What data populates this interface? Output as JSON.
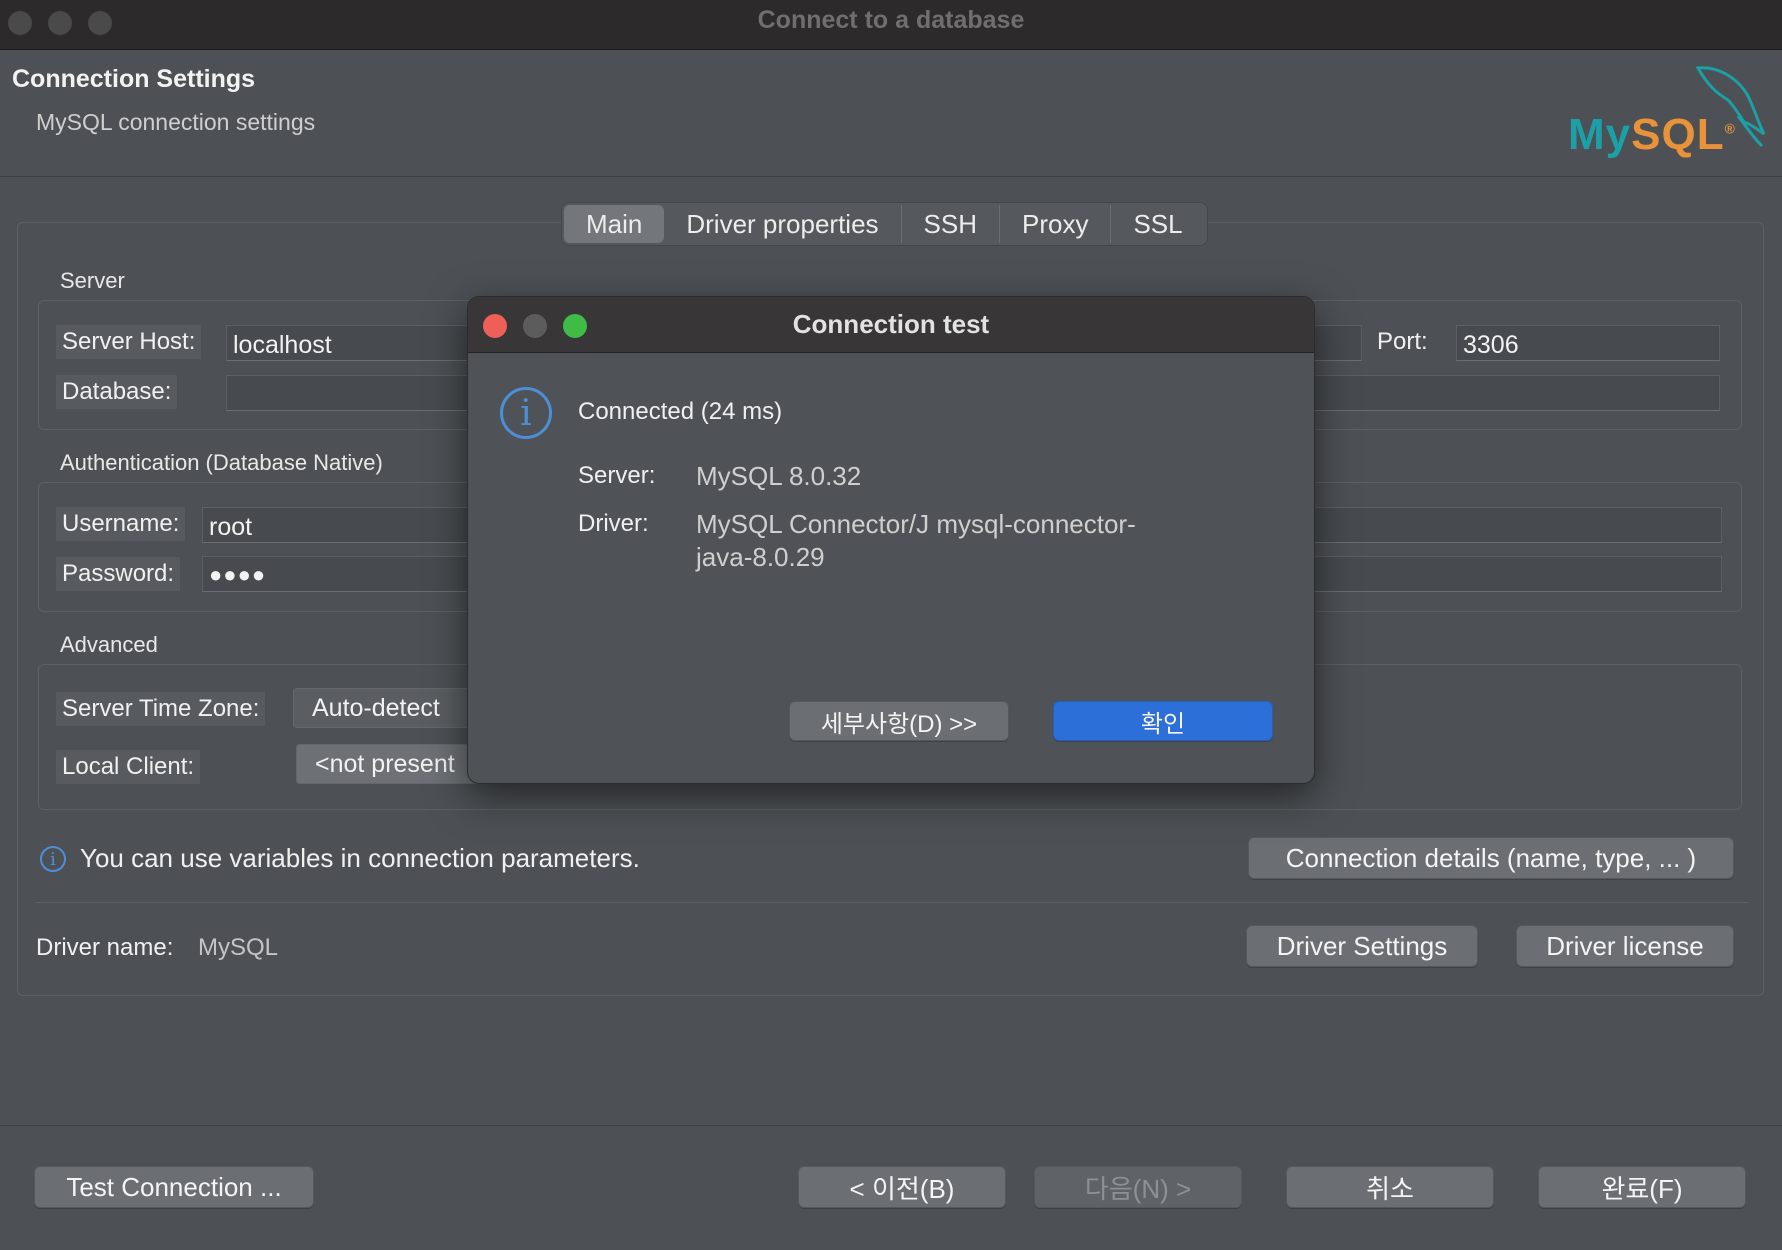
{
  "window": {
    "title": "Connect to a database"
  },
  "header": {
    "title": "Connection Settings",
    "subtitle": "MySQL connection settings",
    "logo_text_a": "My",
    "logo_text_b": "SQL",
    "logo_reg": "®"
  },
  "tabs": [
    {
      "label": "Main",
      "active": true
    },
    {
      "label": "Driver properties"
    },
    {
      "label": "SSH"
    },
    {
      "label": "Proxy"
    },
    {
      "label": "SSL"
    }
  ],
  "server": {
    "section": "Server",
    "host_label": "Server Host:",
    "host_value": "localhost",
    "port_label": "Port:",
    "port_value": "3306",
    "database_label": "Database:",
    "database_value": ""
  },
  "auth": {
    "section": "Authentication (Database Native)",
    "username_label": "Username:",
    "username_value": "root",
    "password_label": "Password:",
    "password_value": "●●●●"
  },
  "advanced": {
    "section": "Advanced",
    "timezone_label": "Server Time Zone:",
    "timezone_value": "Auto-detect",
    "client_label": "Local Client:",
    "client_value": "<not present"
  },
  "hint": {
    "text": "You can use variables in connection parameters."
  },
  "buttons": {
    "connection_details": "Connection details (name, type, ... )",
    "driver_settings": "Driver Settings",
    "driver_license": "Driver license",
    "test_connection": "Test Connection ...",
    "back": "< 이전(B)",
    "next": "다음(N) >",
    "cancel": "취소",
    "finish": "완료(F)"
  },
  "driver": {
    "label": "Driver name:",
    "value": "MySQL"
  },
  "dialog": {
    "title": "Connection test",
    "status": "Connected (24 ms)",
    "server_label": "Server:",
    "server_value": "MySQL 8.0.32",
    "driver_label": "Driver:",
    "driver_value_line1": "MySQL Connector/J mysql-connector-",
    "driver_value_line2": "java-8.0.29",
    "details_button": "세부사항(D) >>",
    "ok_button": "확인",
    "colors": {
      "close": "#ee5f57",
      "minimize": "#5c5c5c",
      "zoom": "#3fbb46",
      "ok": "#2d6fd8",
      "info": "#4c8fd6"
    }
  }
}
